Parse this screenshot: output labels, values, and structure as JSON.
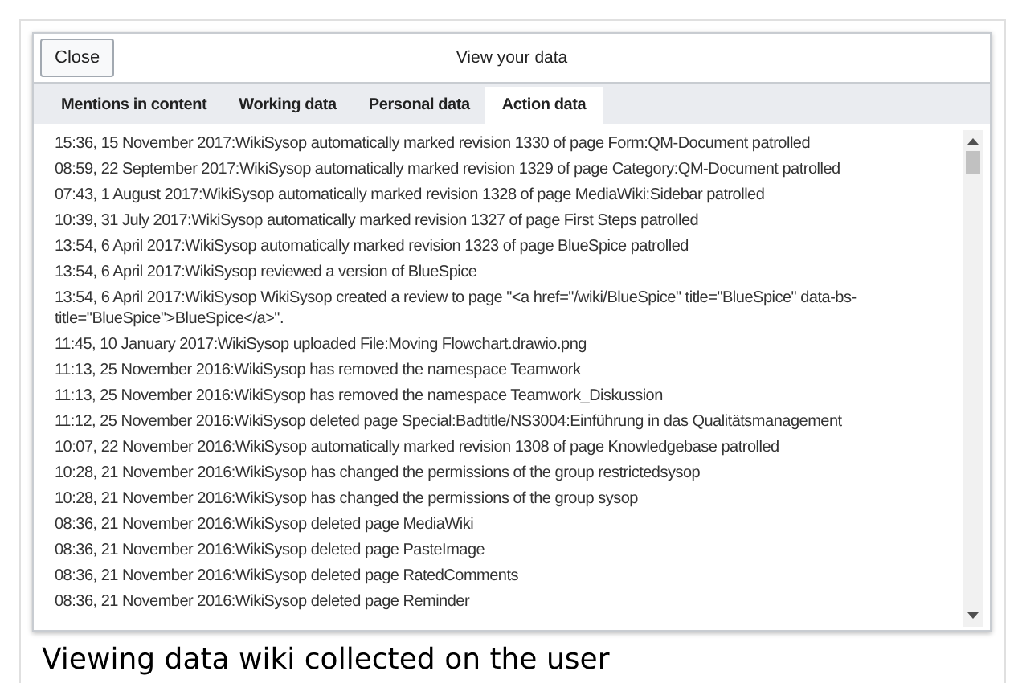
{
  "dialog": {
    "close_button": "Close",
    "title": "View your data"
  },
  "tabs": [
    {
      "label": "Mentions in content",
      "selected": false
    },
    {
      "label": "Working data",
      "selected": false
    },
    {
      "label": "Personal data",
      "selected": false
    },
    {
      "label": "Action data",
      "selected": true
    }
  ],
  "log_entries": [
    "15:36, 15 November 2017:WikiSysop automatically marked revision 1330 of page Form:QM-Document patrolled",
    "08:59, 22 September 2017:WikiSysop automatically marked revision 1329 of page Category:QM-Document patrolled",
    "07:43, 1 August 2017:WikiSysop automatically marked revision 1328 of page MediaWiki:Sidebar patrolled",
    "10:39, 31 July 2017:WikiSysop automatically marked revision 1327 of page First Steps patrolled",
    "13:54, 6 April 2017:WikiSysop automatically marked revision 1323 of page BlueSpice patrolled",
    "13:54, 6 April 2017:WikiSysop reviewed a version of BlueSpice",
    "13:54, 6 April 2017:WikiSysop WikiSysop created a review to page \"<a href=\"/wiki/BlueSpice\" title=\"BlueSpice\" data-bs-title=\"BlueSpice\">BlueSpice</a>\".",
    "11:45, 10 January 2017:WikiSysop uploaded File:Moving Flowchart.drawio.png",
    "11:13, 25 November 2016:WikiSysop has removed the namespace Teamwork",
    "11:13, 25 November 2016:WikiSysop has removed the namespace Teamwork_Diskussion",
    "11:12, 25 November 2016:WikiSysop deleted page Special:Badtitle/NS3004:Einführung in das Qualitätsmanagement",
    "10:07, 22 November 2016:WikiSysop automatically marked revision 1308 of page Knowledgebase patrolled",
    "10:28, 21 November 2016:WikiSysop has changed the permissions of the group restrictedsysop",
    "10:28, 21 November 2016:WikiSysop has changed the permissions of the group sysop",
    "08:36, 21 November 2016:WikiSysop deleted page MediaWiki",
    "08:36, 21 November 2016:WikiSysop deleted page PasteImage",
    "08:36, 21 November 2016:WikiSysop deleted page RatedComments",
    "08:36, 21 November 2016:WikiSysop deleted page Reminder"
  ],
  "caption": "Viewing data wiki collected on the user"
}
